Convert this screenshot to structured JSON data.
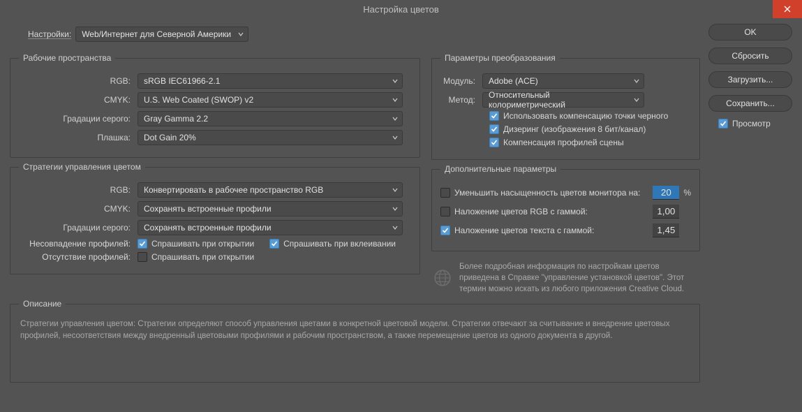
{
  "window": {
    "title": "Настройка цветов"
  },
  "presets": {
    "label": "Настройки:",
    "value": "Web/Интернет для Северной Америки"
  },
  "workspaces": {
    "legend": "Рабочие пространства",
    "rgb_label": "RGB:",
    "rgb_value": "sRGB IEC61966-2.1",
    "cmyk_label": "CMYK:",
    "cmyk_value": "U.S. Web Coated (SWOP) v2",
    "gray_label": "Градации серого:",
    "gray_value": "Gray Gamma 2.2",
    "spot_label": "Плашка:",
    "spot_value": "Dot Gain 20%"
  },
  "policies": {
    "legend": "Стратегии управления цветом",
    "rgb_label": "RGB:",
    "rgb_value": "Конвертировать в рабочее пространство RGB",
    "cmyk_label": "CMYK:",
    "cmyk_value": "Сохранять встроенные профили",
    "gray_label": "Градации серого:",
    "gray_value": "Сохранять встроенные профили",
    "mismatch_label": "Несовпадение профилей:",
    "ask_open": "Спрашивать при открытии",
    "ask_paste": "Спрашивать при вклеивании",
    "missing_label": "Отсутствие профилей:",
    "ask_open2": "Спрашивать при открытии"
  },
  "conversion": {
    "legend": "Параметры преобразования",
    "engine_label": "Модуль:",
    "engine_value": "Adobe (ACE)",
    "intent_label": "Метод:",
    "intent_value": "Относительный колориметрический",
    "bpc": "Использовать компенсацию точки черного",
    "dither": "Дизеринг (изображения 8 бит/канал)",
    "scene": "Компенсация профилей сцены"
  },
  "advanced": {
    "legend": "Дополнительные параметры",
    "desat_label": "Уменьшить насыщенность цветов монитора на:",
    "desat_value": "20",
    "desat_unit": "%",
    "blend_rgb_label": "Наложение цветов RGB с гаммой:",
    "blend_rgb_value": "1,00",
    "blend_text_label": "Наложение цветов текста с гаммой:",
    "blend_text_value": "1,45"
  },
  "info_text": "Более подробная информация по настройкам цветов приведена в Справке \"управление установкой цветов\". Этот термин можно искать из любого приложения Creative Cloud.",
  "description": {
    "legend": "Описание",
    "text": "Стратегии управления цветом:  Стратегии определяют способ управления цветами в конкретной цветовой модели.  Стратегии отвечают за считывание и внедрение цветовых профилей, несоответствия между внедренный цветовыми профилями и рабочим пространством, а также перемещение цветов из одного документа в другой."
  },
  "buttons": {
    "ok": "OK",
    "cancel": "Сбросить",
    "load": "Загрузить...",
    "save": "Сохранить...",
    "preview": "Просмотр"
  }
}
